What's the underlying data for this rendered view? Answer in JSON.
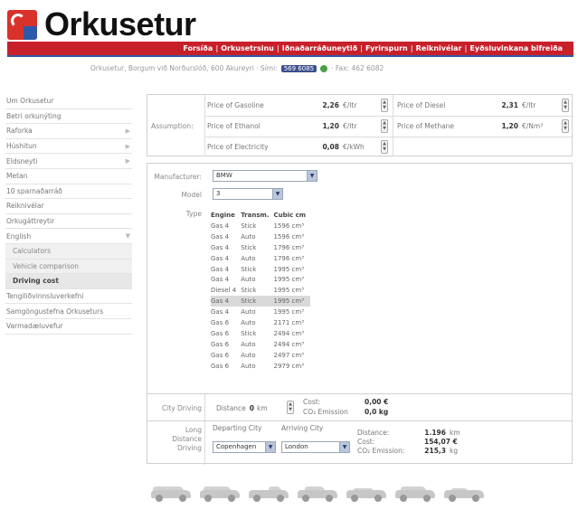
{
  "brand": {
    "name": "Orkusetur",
    "red": "#d8322b",
    "blue": "#2c59a8"
  },
  "nav": [
    "Forsíða",
    "Orkusetrsinu",
    "Iðnaðarráðuneytið",
    "Fyrirspurn",
    "Reiknivélar",
    "Eyðsluvinkana bifreiða"
  ],
  "address": {
    "text": "Orkusetur, Borgum við Norðurslóð, 600 Akureyri · Sími:",
    "phone": "569 6085",
    "fax": "· Fax: 462 6082"
  },
  "sidebar": [
    {
      "label": "Um Orkusetur",
      "arrow": ""
    },
    {
      "label": "Betri orkunýting",
      "arrow": ""
    },
    {
      "label": "Raforka",
      "arrow": "▶"
    },
    {
      "label": "Húshitun",
      "arrow": "▶"
    },
    {
      "label": "Eldsneyti",
      "arrow": "▶"
    },
    {
      "label": "Metan",
      "arrow": ""
    },
    {
      "label": "10 sparnaðarráð",
      "arrow": ""
    },
    {
      "label": "Reiknivélar",
      "arrow": ""
    },
    {
      "label": "Orkugáttreytir",
      "arrow": ""
    },
    {
      "label": "English",
      "arrow": "▼"
    },
    {
      "label": "Calculators",
      "arrow": "",
      "sub": true
    },
    {
      "label": "Vehicle comparison",
      "arrow": "",
      "sub": true
    },
    {
      "label": "Driving cost",
      "arrow": "",
      "sub": true,
      "active": true
    },
    {
      "label": "Tengiliðvinnsluverkefni",
      "arrow": ""
    },
    {
      "label": "Samgöngustefna Orkuseturs",
      "arrow": ""
    },
    {
      "label": "Varmadæluvefur",
      "arrow": ""
    }
  ],
  "assumptions": {
    "label": "Assumption:",
    "gasoline": {
      "label": "Price of Gasoline",
      "value": "2,26",
      "unit": "€/ltr"
    },
    "ethanol": {
      "label": "Price of Ethanol",
      "value": "1,20",
      "unit": "€/ltr"
    },
    "electricity": {
      "label": "Price of Electricity",
      "value": "0,08",
      "unit": "€/kWh"
    },
    "diesel": {
      "label": "Price of Diesel",
      "value": "2,31",
      "unit": "€/ltr"
    },
    "methane": {
      "label": "Price of Methane",
      "value": "1,20",
      "unit": "€/Nm³"
    }
  },
  "form": {
    "manufacturer_label": "Manufacturer:",
    "manufacturer_value": "BMW",
    "model_label": "Model",
    "model_value": "3",
    "type_label": "Type",
    "headers": [
      "Engine",
      "Transm.",
      "Cubic cm"
    ],
    "rows": [
      [
        "Gas 4",
        "Stick",
        "1596 cm³"
      ],
      [
        "Gas 4",
        "Auto",
        "1596 cm³"
      ],
      [
        "Gas 4",
        "Stick",
        "1796 cm³"
      ],
      [
        "Gas 4",
        "Auto",
        "1796 cm³"
      ],
      [
        "Gas 4",
        "Stick",
        "1995 cm³"
      ],
      [
        "Gas 4",
        "Auto",
        "1995 cm³"
      ],
      [
        "Diesel 4",
        "Stick",
        "1995 cm³"
      ],
      [
        "Gas 4",
        "Stick",
        "1995 cm³"
      ],
      [
        "Gas 4",
        "Auto",
        "1995 cm³"
      ],
      [
        "Gas 6",
        "Auto",
        "2171 cm³"
      ],
      [
        "Gas 6",
        "Stick",
        "2494 cm³"
      ],
      [
        "Gas 6",
        "Auto",
        "2494 cm³"
      ],
      [
        "Gas 6",
        "Auto",
        "2497 cm³"
      ],
      [
        "Gas 6",
        "Auto",
        "2979 cm³"
      ]
    ],
    "selected_row": 7
  },
  "city": {
    "label": "City Driving",
    "distance_label": "Distance",
    "distance_value": "0",
    "distance_unit": "km",
    "cost_label": "Cost:",
    "cost_value": "0,00 €",
    "co2_label": "CO₂ Emission",
    "co2_value": "0,0 kg"
  },
  "long": {
    "label_1": "Long",
    "label_2": "Distance",
    "label_3": "Driving",
    "departing_label": "Departing City",
    "arriving_label": "Arriving City",
    "departing_value": "Copenhagen",
    "arriving_value": "London",
    "distance_label": "Distance:",
    "distance_value": "1.196",
    "distance_unit": "km",
    "cost_label": "Cost:",
    "cost_value": "154,07 €",
    "co2_label": "CO₂ Emission:",
    "co2_value": "215,3",
    "co2_unit": "kg"
  },
  "car_icons": [
    "van-icon",
    "minivan-icon",
    "pickup-icon",
    "hatchback-icon",
    "sedan-icon",
    "wagon-icon",
    "coupe-icon"
  ]
}
